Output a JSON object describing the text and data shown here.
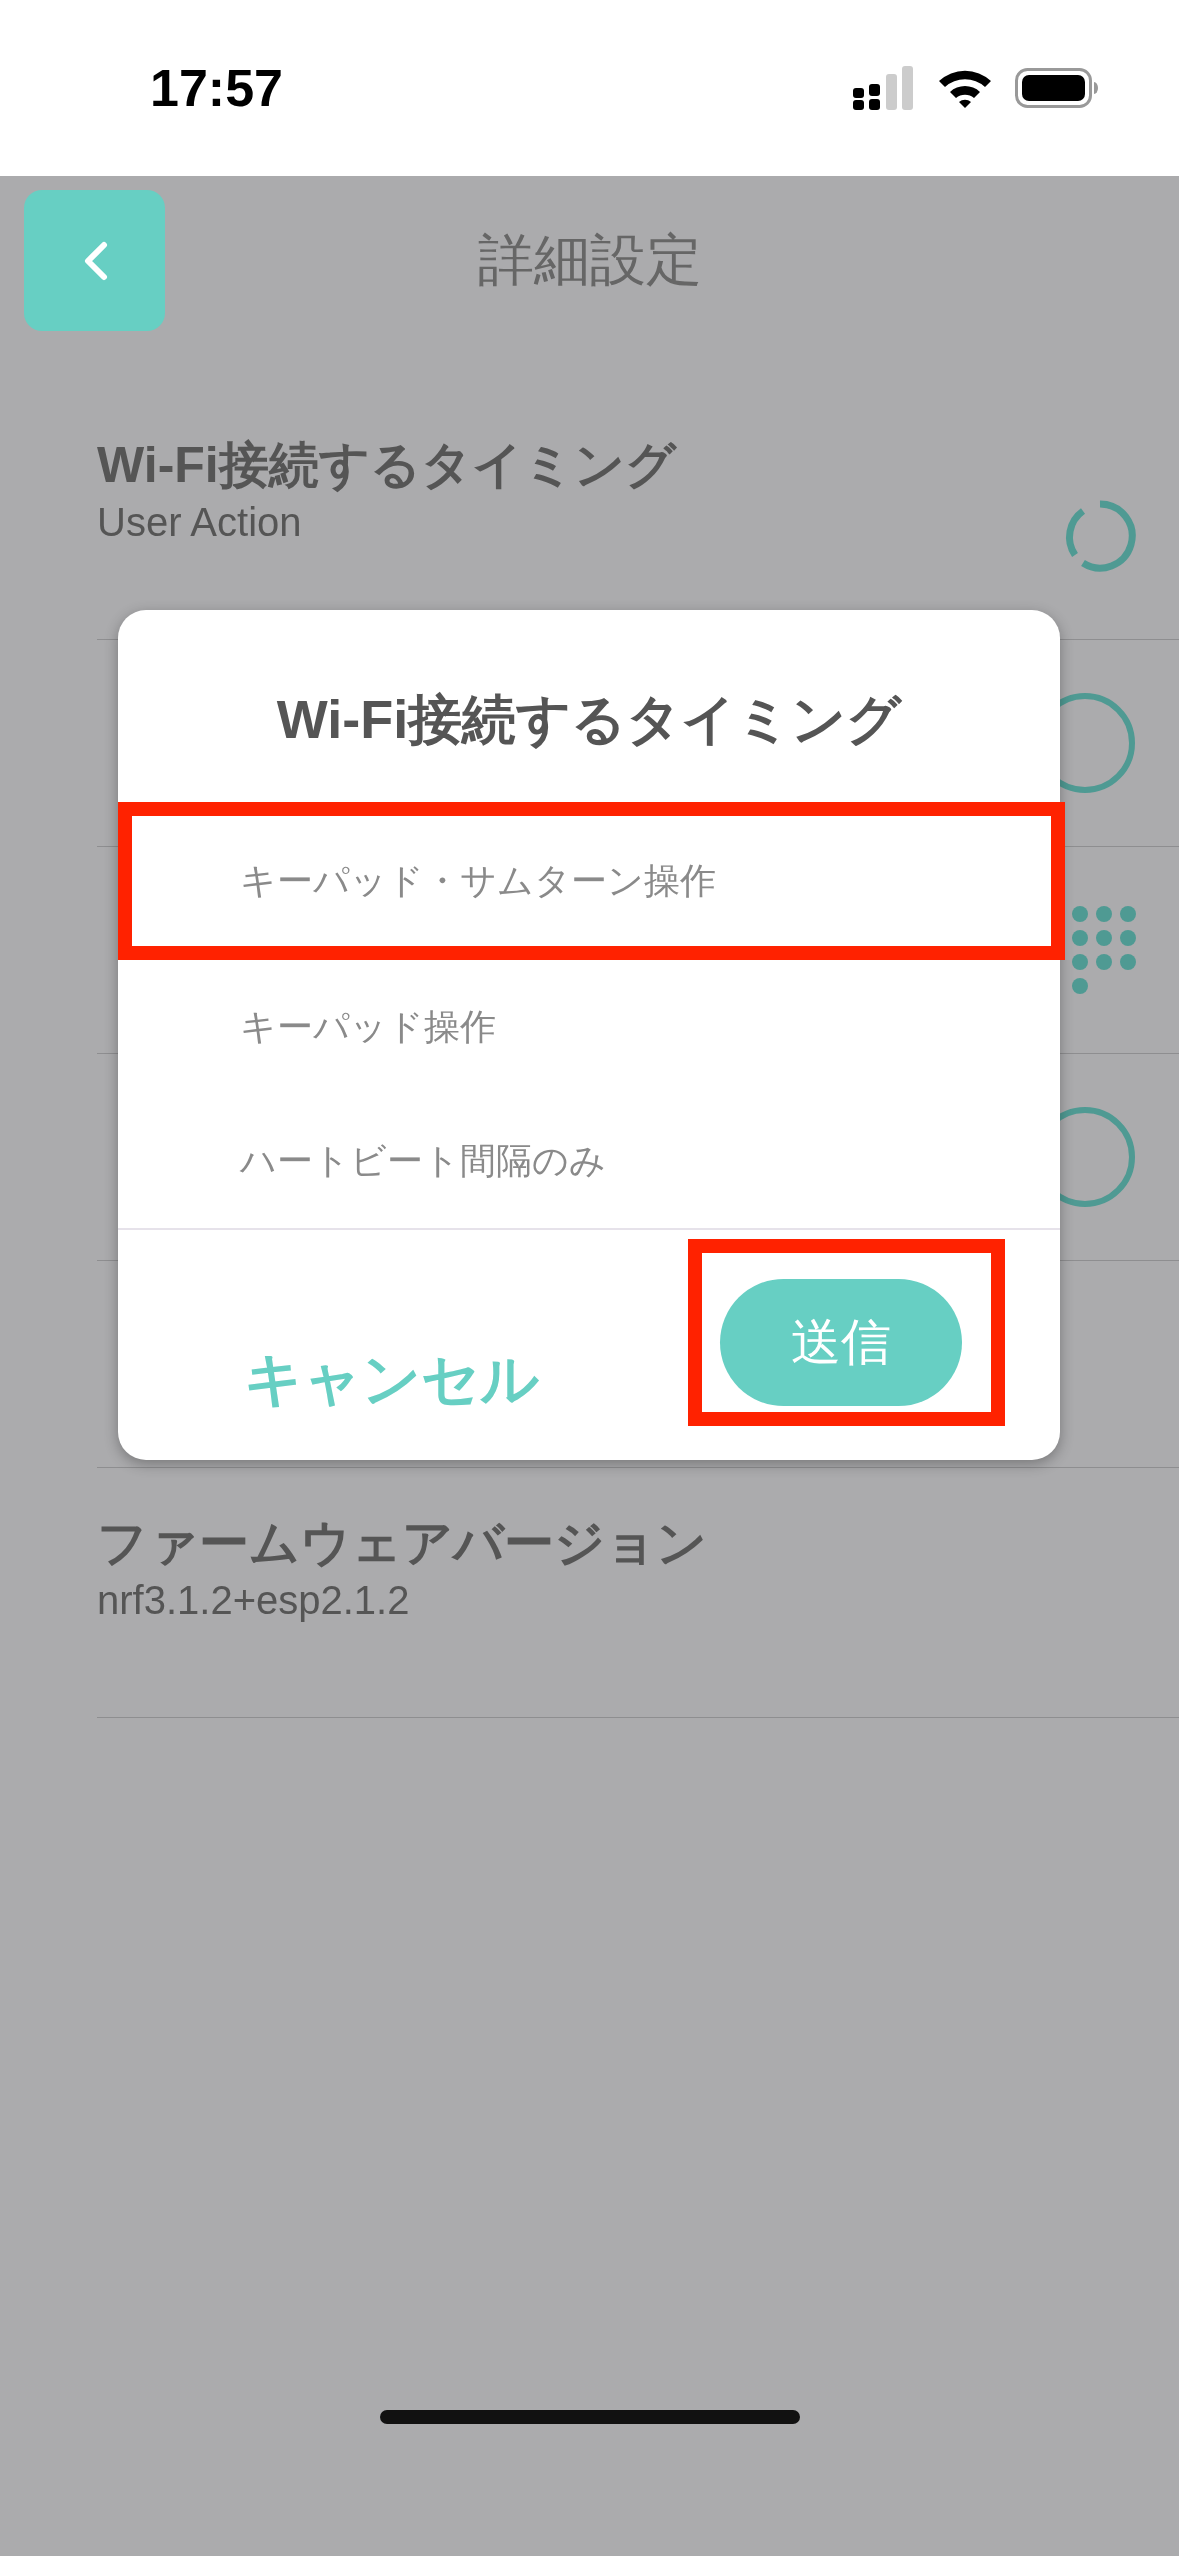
{
  "status_bar": {
    "time": "17:57"
  },
  "header": {
    "title": "詳細設定"
  },
  "settings": [
    {
      "kind": "loading",
      "title": "Wi-Fi接続するタイミング",
      "subtitle": "User Action"
    },
    {
      "kind": "ring"
    },
    {
      "kind": "grid"
    },
    {
      "kind": "ring"
    },
    {
      "kind": "plain"
    },
    {
      "kind": "plain",
      "title": "ファームウェアバージョン",
      "subtitle": "nrf3.1.2+esp2.1.2"
    }
  ],
  "dialog": {
    "title": "Wi-Fi接続するタイミング",
    "options": [
      {
        "label": "キーパッド・サムターン操作",
        "highlighted": true
      },
      {
        "label": "キーパッド操作",
        "highlighted": false
      },
      {
        "label": "ハートビート間隔のみ",
        "highlighted": false
      }
    ],
    "cancel": {
      "label": "キャンセル"
    },
    "submit": {
      "label": "送信",
      "highlighted": true
    }
  }
}
